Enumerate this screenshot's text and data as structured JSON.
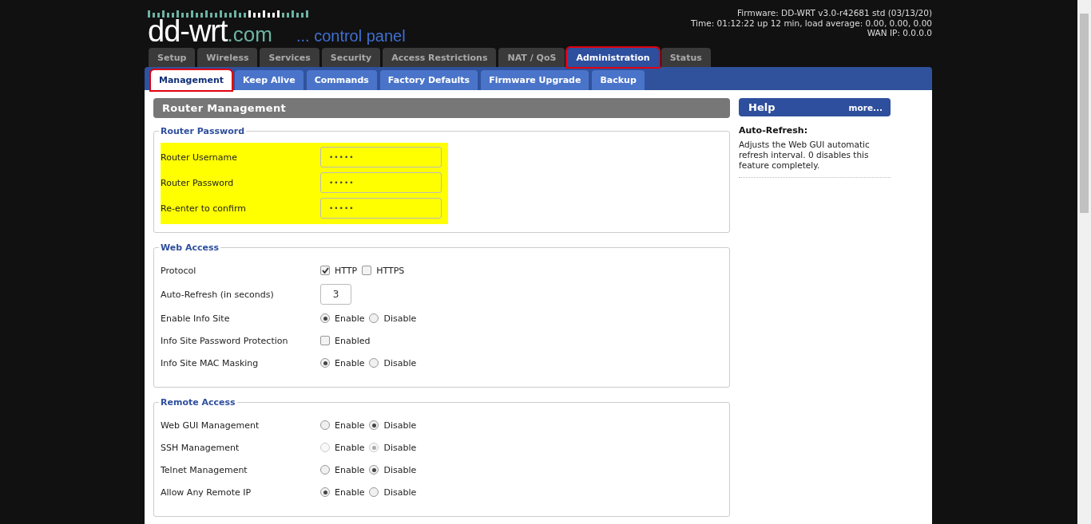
{
  "header": {
    "logo": {
      "name": "dd-wrt",
      "tld": ".com",
      "tagline": "... control panel"
    },
    "info": [
      "Firmware: DD-WRT v3.0-r42681 std (03/13/20)",
      "Time: 01:12:22 up 12 min, load average: 0.00, 0.00, 0.00",
      "WAN IP: 0.0.0.0"
    ]
  },
  "tabs": [
    {
      "label": "Setup",
      "selected": false,
      "highlighted": false
    },
    {
      "label": "Wireless",
      "selected": false,
      "highlighted": false
    },
    {
      "label": "Services",
      "selected": false,
      "highlighted": false
    },
    {
      "label": "Security",
      "selected": false,
      "highlighted": false
    },
    {
      "label": "Access Restrictions",
      "selected": false,
      "highlighted": false
    },
    {
      "label": "NAT / QoS",
      "selected": false,
      "highlighted": false
    },
    {
      "label": "Administration",
      "selected": true,
      "highlighted": true
    },
    {
      "label": "Status",
      "selected": false,
      "highlighted": false
    }
  ],
  "subtabs": [
    {
      "label": "Management",
      "selected": true,
      "highlighted": true
    },
    {
      "label": "Keep Alive",
      "selected": false,
      "highlighted": false
    },
    {
      "label": "Commands",
      "selected": false,
      "highlighted": false
    },
    {
      "label": "Factory Defaults",
      "selected": false,
      "highlighted": false
    },
    {
      "label": "Firmware Upgrade",
      "selected": false,
      "highlighted": false
    },
    {
      "label": "Backup",
      "selected": false,
      "highlighted": false
    }
  ],
  "section_title": "Router Management",
  "groups": [
    {
      "legend": "Router Password",
      "highlighted": true,
      "rows": [
        {
          "label": "Router Username",
          "kind": "password",
          "value": "•••••"
        },
        {
          "label": "Router Password",
          "kind": "password",
          "value": "•••••"
        },
        {
          "label": "Re-enter to confirm",
          "kind": "password",
          "value": "•••••"
        }
      ]
    },
    {
      "legend": "Web Access",
      "highlighted": false,
      "rows": [
        {
          "label": "Protocol",
          "kind": "checkboxes",
          "options": [
            {
              "label": "HTTP",
              "checked": true,
              "disabled": false
            },
            {
              "label": "HTTPS",
              "checked": false,
              "disabled": false
            }
          ]
        },
        {
          "label": "Auto-Refresh (in seconds)",
          "kind": "number",
          "value": "3"
        },
        {
          "label": "Enable Info Site",
          "kind": "radio",
          "options": [
            {
              "label": "Enable",
              "checked": true,
              "disabled": false
            },
            {
              "label": "Disable",
              "checked": false,
              "disabled": false
            }
          ]
        },
        {
          "label": "Info Site Password Protection",
          "kind": "checkboxes",
          "options": [
            {
              "label": "Enabled",
              "checked": false,
              "disabled": false
            }
          ]
        },
        {
          "label": "Info Site MAC Masking",
          "kind": "radio",
          "options": [
            {
              "label": "Enable",
              "checked": true,
              "disabled": false
            },
            {
              "label": "Disable",
              "checked": false,
              "disabled": false
            }
          ]
        }
      ]
    },
    {
      "legend": "Remote Access",
      "highlighted": false,
      "rows": [
        {
          "label": "Web GUI Management",
          "kind": "radio",
          "options": [
            {
              "label": "Enable",
              "checked": false,
              "disabled": false
            },
            {
              "label": "Disable",
              "checked": true,
              "disabled": false
            }
          ]
        },
        {
          "label": "SSH Management",
          "kind": "radio",
          "options": [
            {
              "label": "Enable",
              "checked": false,
              "disabled": true
            },
            {
              "label": "Disable",
              "checked": true,
              "disabled": true
            }
          ]
        },
        {
          "label": "Telnet Management",
          "kind": "radio",
          "options": [
            {
              "label": "Enable",
              "checked": false,
              "disabled": false
            },
            {
              "label": "Disable",
              "checked": true,
              "disabled": false
            }
          ]
        },
        {
          "label": "Allow Any Remote IP",
          "kind": "radio",
          "options": [
            {
              "label": "Enable",
              "checked": true,
              "disabled": false
            },
            {
              "label": "Disable",
              "checked": false,
              "disabled": false
            }
          ]
        }
      ]
    }
  ],
  "help": {
    "title": "Help",
    "more": "more...",
    "heading": "Auto-Refresh:",
    "text": "Adjusts the Web GUI automatic refresh interval. 0 disables this feature completely."
  }
}
